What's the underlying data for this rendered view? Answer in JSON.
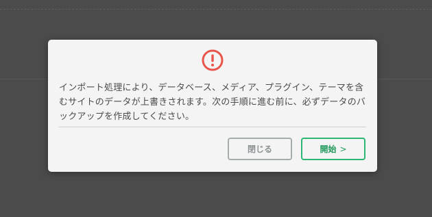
{
  "dialog": {
    "message": "インポート処理により、データベース、メディア、プラグイン、テーマを含むサイトのデータが上書きされます。次の手順に進む前に、必ずデータのバックアップを作成してください。",
    "icon": "warning-circle-icon",
    "close_label": "閉じる",
    "start_label": "開始",
    "start_chevron": ">"
  },
  "colors": {
    "warning": "#e8554b",
    "accent": "#2bb673",
    "overlay": "#4b4b4b"
  }
}
